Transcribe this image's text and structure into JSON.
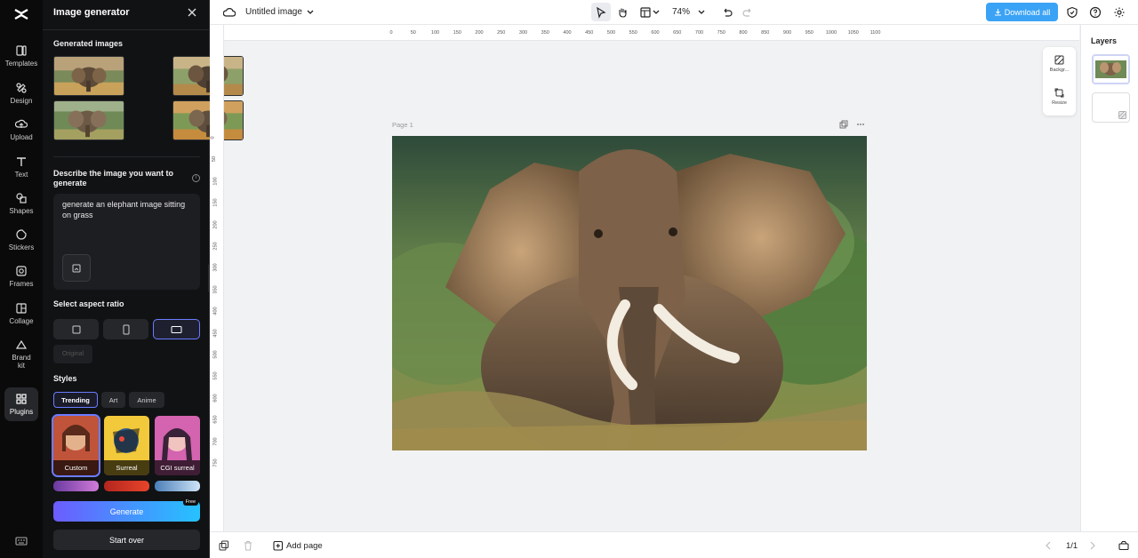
{
  "app": {
    "title": "Untitled image",
    "zoom": "74%",
    "download_label": "Download all"
  },
  "rail": {
    "items": [
      {
        "label": "Templates",
        "icon": "templates-icon"
      },
      {
        "label": "Design",
        "icon": "design-icon"
      },
      {
        "label": "Upload",
        "icon": "upload-icon"
      },
      {
        "label": "Text",
        "icon": "text-icon"
      },
      {
        "label": "Shapes",
        "icon": "shapes-icon"
      },
      {
        "label": "Stickers",
        "icon": "stickers-icon"
      },
      {
        "label": "Frames",
        "icon": "frames-icon"
      },
      {
        "label": "Collage",
        "icon": "collage-icon"
      },
      {
        "label": "Brand kit",
        "icon": "brand-kit-icon"
      },
      {
        "label": "Plugins",
        "icon": "plugins-icon"
      }
    ]
  },
  "panel": {
    "title": "Image generator",
    "generated_label": "Generated images",
    "describe_label": "Describe the image you want to generate",
    "prompt_value": "generate an elephant image sitting on grass",
    "aspect_label": "Select aspect ratio",
    "original_label": "Original",
    "styles_label": "Styles",
    "style_tabs": [
      "Trending",
      "Art",
      "Anime"
    ],
    "style_cards": [
      "Custom",
      "Surreal",
      "CGI surreal"
    ],
    "generate_label": "Generate",
    "free_badge": "Free",
    "start_over_label": "Start over"
  },
  "ruler": {
    "top": [
      "0",
      "50",
      "100",
      "150",
      "200",
      "250",
      "300",
      "350",
      "400",
      "450",
      "500",
      "550",
      "600",
      "650",
      "700",
      "750",
      "800",
      "850",
      "900",
      "950",
      "1000",
      "1050",
      "1100"
    ],
    "left": [
      "0",
      "50",
      "100",
      "150",
      "200",
      "250",
      "300",
      "350",
      "400",
      "450",
      "500",
      "550",
      "600",
      "650",
      "700",
      "750"
    ]
  },
  "canvas": {
    "page_label": "Page 1"
  },
  "side_tools": {
    "background_label": "Backgr...",
    "resize_label": "Resize"
  },
  "layers": {
    "title": "Layers"
  },
  "bottom": {
    "add_page_label": "Add page",
    "pager": "1/1"
  },
  "colors": {
    "accent": "#6b7cff",
    "download": "#3ba3f5",
    "panel_bg": "#111214"
  }
}
